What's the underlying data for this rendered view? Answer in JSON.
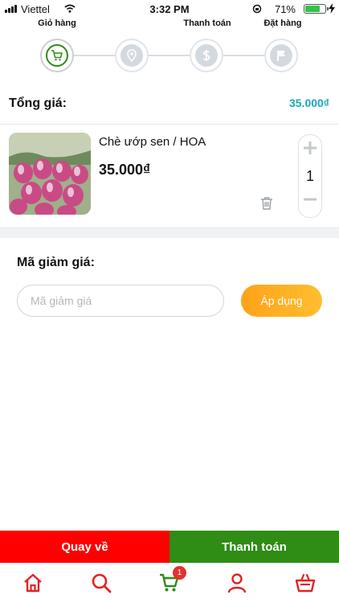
{
  "status_bar": {
    "carrier": "Viettel",
    "time": "3:32 PM",
    "battery": "71%",
    "battery_level": 0.71
  },
  "steps": [
    {
      "label": "Giỏ hàng",
      "icon": "cart-icon",
      "active": true
    },
    {
      "label": "",
      "icon": "location-pin-icon",
      "active": false
    },
    {
      "label": "Thanh toán",
      "icon": "dollar-icon",
      "active": false
    },
    {
      "label": "Đặt hàng",
      "icon": "flag-icon",
      "active": false
    }
  ],
  "summary": {
    "total_label": "Tổng giá:",
    "total_value": "35.000₫"
  },
  "cart_item": {
    "name": "Chè ướp sen / HOA",
    "price": "35.000₫",
    "quantity": "1"
  },
  "coupon": {
    "label": "Mã giảm giá:",
    "placeholder": "Mã giảm giá",
    "value": "",
    "apply_label": "Áp dụng"
  },
  "actions": {
    "back_label": "Quay về",
    "checkout_label": "Thanh toán"
  },
  "tabbar": {
    "items": [
      {
        "icon": "home-icon"
      },
      {
        "icon": "search-icon"
      },
      {
        "icon": "cart-icon",
        "badge": "1"
      },
      {
        "icon": "user-icon"
      },
      {
        "icon": "basket-icon"
      }
    ]
  },
  "colors": {
    "accent_red": "#ff0000",
    "accent_green": "#2f8c14",
    "price_teal": "#19a7b8",
    "apply_orange": "#ffa21a"
  }
}
